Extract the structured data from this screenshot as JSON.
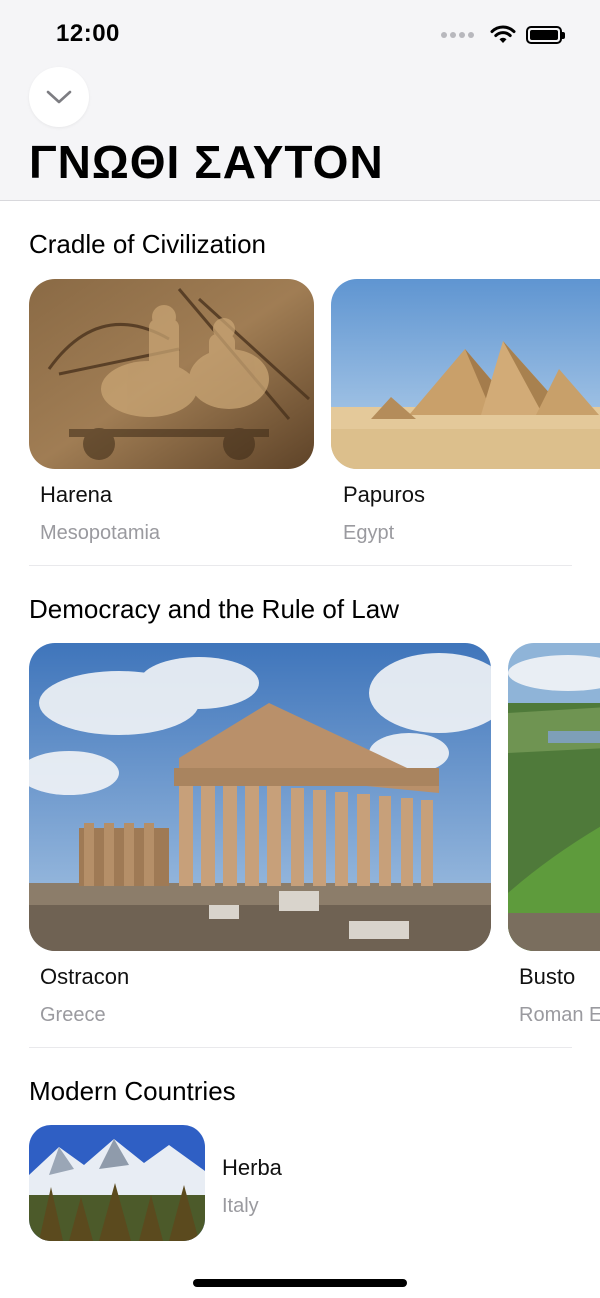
{
  "status_bar": {
    "time": "12:00"
  },
  "header": {
    "title": "ΓΝΩΘΙ ΣΑΥΤΟΝ"
  },
  "sections": [
    {
      "title": "Cradle of Civilization",
      "items": [
        {
          "title": "Harena",
          "subtitle": "Mesopotamia",
          "image": "assyrian-relief"
        },
        {
          "title": "Papuros",
          "subtitle": "Egypt",
          "image": "pyramids"
        }
      ]
    },
    {
      "title": "Democracy and the Rule of Law",
      "items": [
        {
          "title": "Ostracon",
          "subtitle": "Greece",
          "image": "parthenon"
        },
        {
          "title": "Busto",
          "subtitle": "Roman E",
          "image": "green-hills"
        }
      ]
    },
    {
      "title": "Modern Countries",
      "items": [
        {
          "title": "Herba",
          "subtitle": "Italy",
          "image": "alps"
        }
      ]
    }
  ],
  "colors": {
    "header_bg": "#f5f5f7",
    "subtitle": "#9a9a9f",
    "divider": "#e9e9ec"
  },
  "icons": [
    "chevron-down-icon",
    "wifi-icon",
    "battery-icon",
    "cellular-icon"
  ]
}
